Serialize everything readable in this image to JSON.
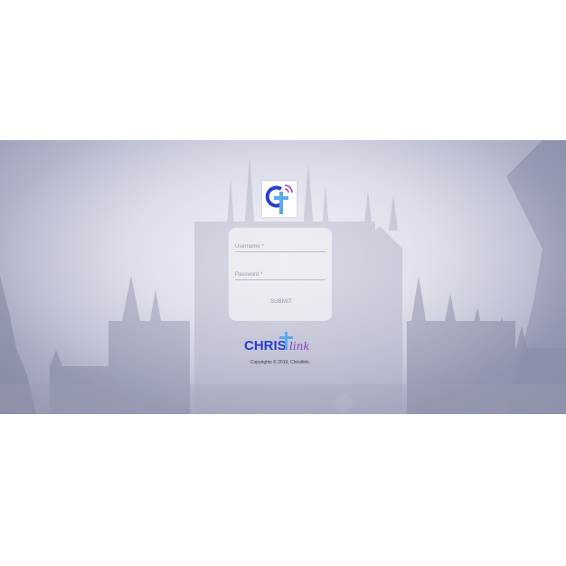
{
  "login": {
    "username_label": "Username *",
    "password_label": "Password *",
    "submit_label": "SUBMIT"
  },
  "brand": {
    "name_part1": "CHRIS",
    "name_part2": "link",
    "primary_color": "#2a3fd0",
    "accent_color": "#5aa9e8",
    "script_color": "#8a3fc7"
  },
  "footer": {
    "copyright": "Copyrights © 2019, Christlink."
  },
  "icons": {
    "logo": "christlink-logo-icon"
  }
}
